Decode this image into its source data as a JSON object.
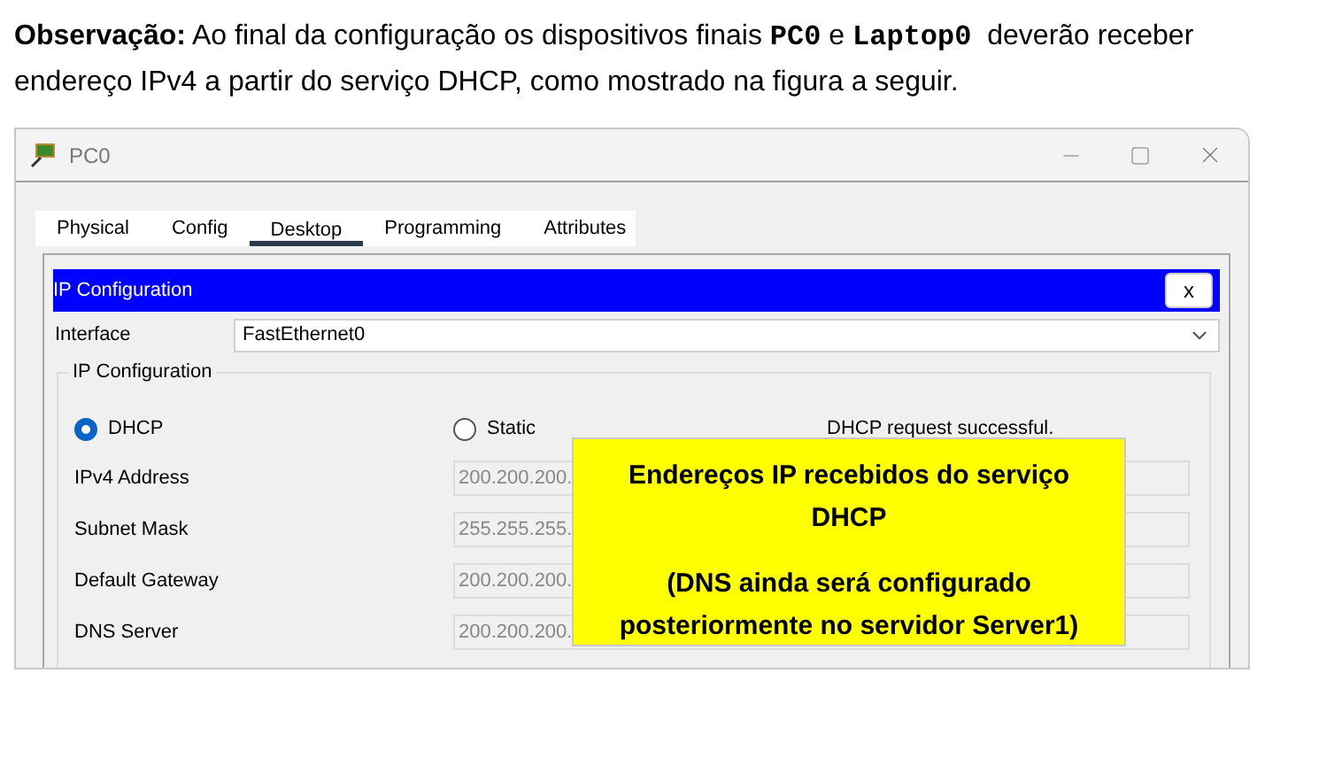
{
  "intro": {
    "parts": [
      {
        "kind": "bold",
        "text": "Observação:"
      },
      {
        "kind": "plain",
        "text": " Ao final da configuração os dispositivos finais "
      },
      {
        "kind": "code",
        "text": "PC0"
      },
      {
        "kind": "plain",
        "text": " e "
      },
      {
        "kind": "code",
        "text": "Laptop0"
      },
      {
        "kind": "plain",
        "text": "  deverão receber endereço IPv4 a partir do serviço DHCP, como mostrado na figura a seguir."
      }
    ]
  },
  "window": {
    "title": "PC0",
    "tabs": [
      {
        "label": "Physical",
        "selected": false
      },
      {
        "label": "Config",
        "selected": false
      },
      {
        "label": "Desktop",
        "selected": true
      },
      {
        "label": "Programming",
        "selected": false
      },
      {
        "label": "Attributes",
        "selected": false
      }
    ],
    "panel": {
      "title": "IP Configuration",
      "close": "x",
      "interface_label": "Interface",
      "interface_value": "FastEthernet0",
      "group_title": "IP Configuration",
      "modes": [
        {
          "label": "DHCP",
          "selected": true
        },
        {
          "label": "Static",
          "selected": false
        }
      ],
      "status": "DHCP request successful.",
      "fields": [
        {
          "label": "IPv4 Address",
          "value": "200.200.200."
        },
        {
          "label": "Subnet Mask",
          "value": "255.255.255."
        },
        {
          "label": "Default Gateway",
          "value": "200.200.200."
        },
        {
          "label": "DNS Server",
          "value": "200.200.200."
        }
      ]
    }
  },
  "note": {
    "lines": [
      "Endereços IP recebidos do serviço DHCP",
      "(DNS ainda será configurado posteriormente no servidor Server1)"
    ]
  }
}
